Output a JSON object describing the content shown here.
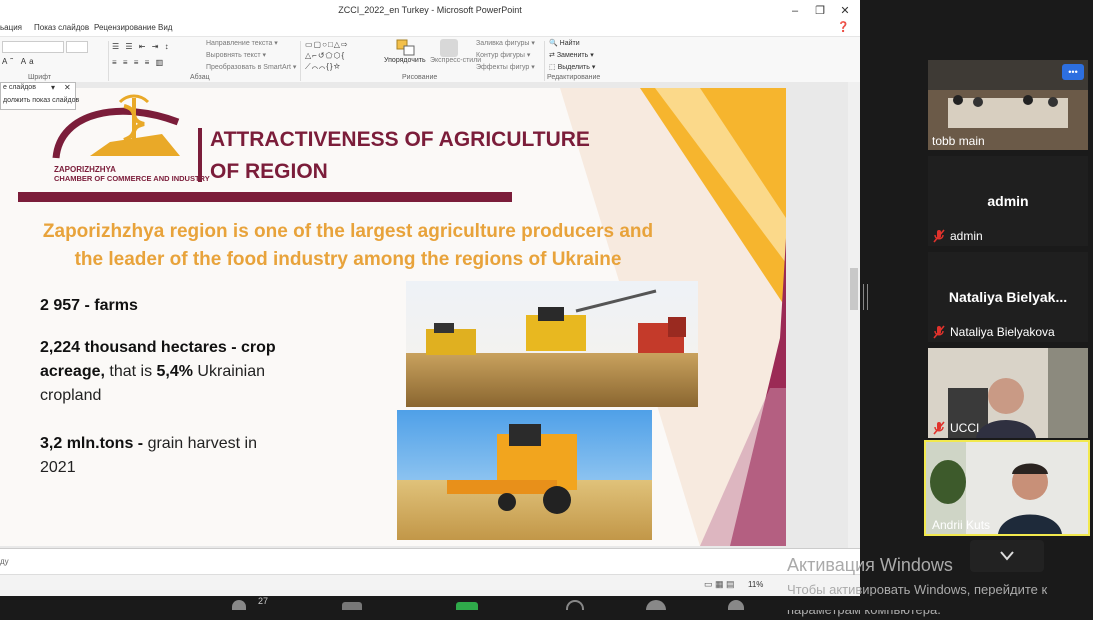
{
  "window": {
    "title": "ZCCI_2022_en Turkey - Microsoft PowerPoint",
    "controls": {
      "minimize": "–",
      "restore": "❐",
      "close": "✕"
    }
  },
  "ribbon_tabs": [
    "ьация",
    "Показ слайдов",
    "Рецензирование",
    "Вид"
  ],
  "ribbon": {
    "para_items": [
      "Направление текста ▾",
      "Выровнять текст ▾",
      "Преобразовать в SmartArt ▾"
    ],
    "arrange_label": "Упорядочить",
    "express_styles": "Экспресс-стили",
    "shape_options": [
      "Заливка фигуры ▾",
      "Контур фигуры ▾",
      "Эффекты фигур ▾"
    ],
    "edit_items": [
      "Найти",
      "Заменить ▾",
      "Выделить ▾"
    ],
    "groups": [
      "Шрифт",
      "Абзац",
      "Рисование",
      "Редактирование"
    ]
  },
  "panel_hint": {
    "title": "е слайдов",
    "action": "должить показ слайдов"
  },
  "notes_placeholder": "ду",
  "zoom_level": "11%",
  "slide": {
    "title": "ATTRACTIVENESS OF AGRICULTURE\nOF REGION",
    "logo_line1": "ZAPORIZHZHYA",
    "logo_line2": "CHAMBER OF COMMERCE AND INDUSTRY",
    "headline": "Zaporizhzhya region is one of the largest agriculture producers and  the leader of the food industry among the regions of Ukraine",
    "facts": [
      {
        "bold": "2 957 -  farms",
        "rest": ""
      },
      {
        "bold": "2,224 thousand hectares - crop acreage,",
        "mid": " that is ",
        "bold2": "5,4%",
        "rest": " Ukrainian cropland"
      },
      {
        "bold": "3,2 mln.tons  -",
        "rest": "  grain harvest in 2021"
      }
    ]
  },
  "participants": [
    {
      "name": "tobb main",
      "type": "video",
      "muted": false
    },
    {
      "name": "admin",
      "display": "admin",
      "type": "avatar",
      "muted": true
    },
    {
      "name": "Nataliya Bielyakova",
      "display": "Nataliya  Bielyak...",
      "type": "avatar",
      "muted": true
    },
    {
      "name": "UCCI",
      "type": "video",
      "muted": true
    },
    {
      "name": "Andrii Kuts",
      "type": "video",
      "muted": false,
      "active_speaker": true
    }
  ],
  "more_button": "•••",
  "participant_count": "27",
  "watermark": {
    "line1": "Активация Windows",
    "line2": "Чтобы активировать Windows, перейдите к",
    "line3": "параметрам компьютера."
  },
  "colors": {
    "maroon": "#7b1d3a",
    "gold": "#e8a33b",
    "active_border": "#f2e94e",
    "muted_mic": "#e0322c"
  }
}
